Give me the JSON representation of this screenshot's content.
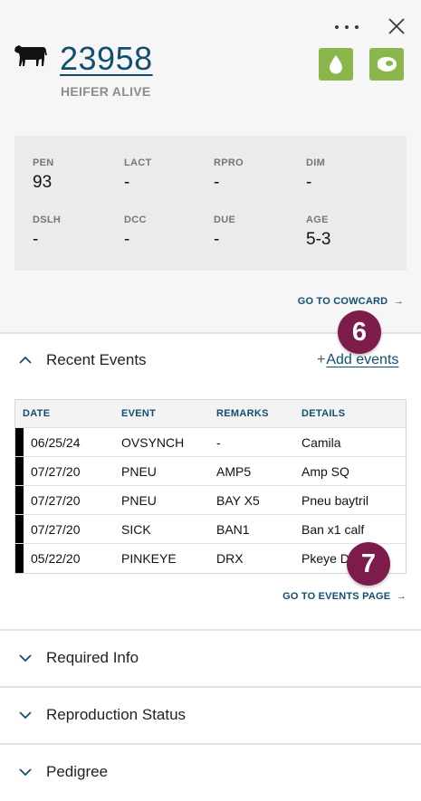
{
  "header": {
    "cow_id": "23958",
    "status": "HEIFER ALIVE",
    "icons": {
      "more": "more-options-icon",
      "close": "close-icon",
      "animal": "cow-icon",
      "action_1": "water-drop-icon",
      "action_2": "steak-icon"
    },
    "colors": {
      "accent": "#124f6e",
      "action": "#8bb64c",
      "badge": "#7d1c4a"
    }
  },
  "stats": [
    {
      "label": "PEN",
      "value": "93"
    },
    {
      "label": "LACT",
      "value": "-"
    },
    {
      "label": "RPRO",
      "value": "-"
    },
    {
      "label": "DIM",
      "value": "-"
    },
    {
      "label": "DSLH",
      "value": "-"
    },
    {
      "label": "DCC",
      "value": "-"
    },
    {
      "label": "DUE",
      "value": "-"
    },
    {
      "label": "AGE",
      "value": "5-3"
    }
  ],
  "links": {
    "cowcard": "GO TO COWCARD",
    "events_page": "GO TO EVENTS PAGE"
  },
  "recent_events": {
    "title": "Recent Events",
    "add_plus": "+",
    "add_label": "Add events",
    "columns": [
      "DATE",
      "EVENT",
      "REMARKS",
      "DETAILS"
    ],
    "rows": [
      {
        "date": "06/25/24",
        "event": "OVSYNCH",
        "remarks": "-",
        "details": "Camila"
      },
      {
        "date": "07/27/20",
        "event": "PNEU",
        "remarks": "AMP5",
        "details": "Amp SQ"
      },
      {
        "date": "07/27/20",
        "event": "PNEU",
        "remarks": "BAY X5",
        "details": "Pneu baytril"
      },
      {
        "date": "07/27/20",
        "event": "SICK",
        "remarks": "BAN1",
        "details": "Ban x1 calf"
      },
      {
        "date": "05/22/20",
        "event": "PINKEYE",
        "remarks": "DRX",
        "details": "Pkeye D"
      }
    ]
  },
  "badges": {
    "first": "6",
    "second": "7"
  },
  "sections": [
    {
      "title": "Required Info"
    },
    {
      "title": "Reproduction Status"
    },
    {
      "title": "Pedigree"
    }
  ]
}
